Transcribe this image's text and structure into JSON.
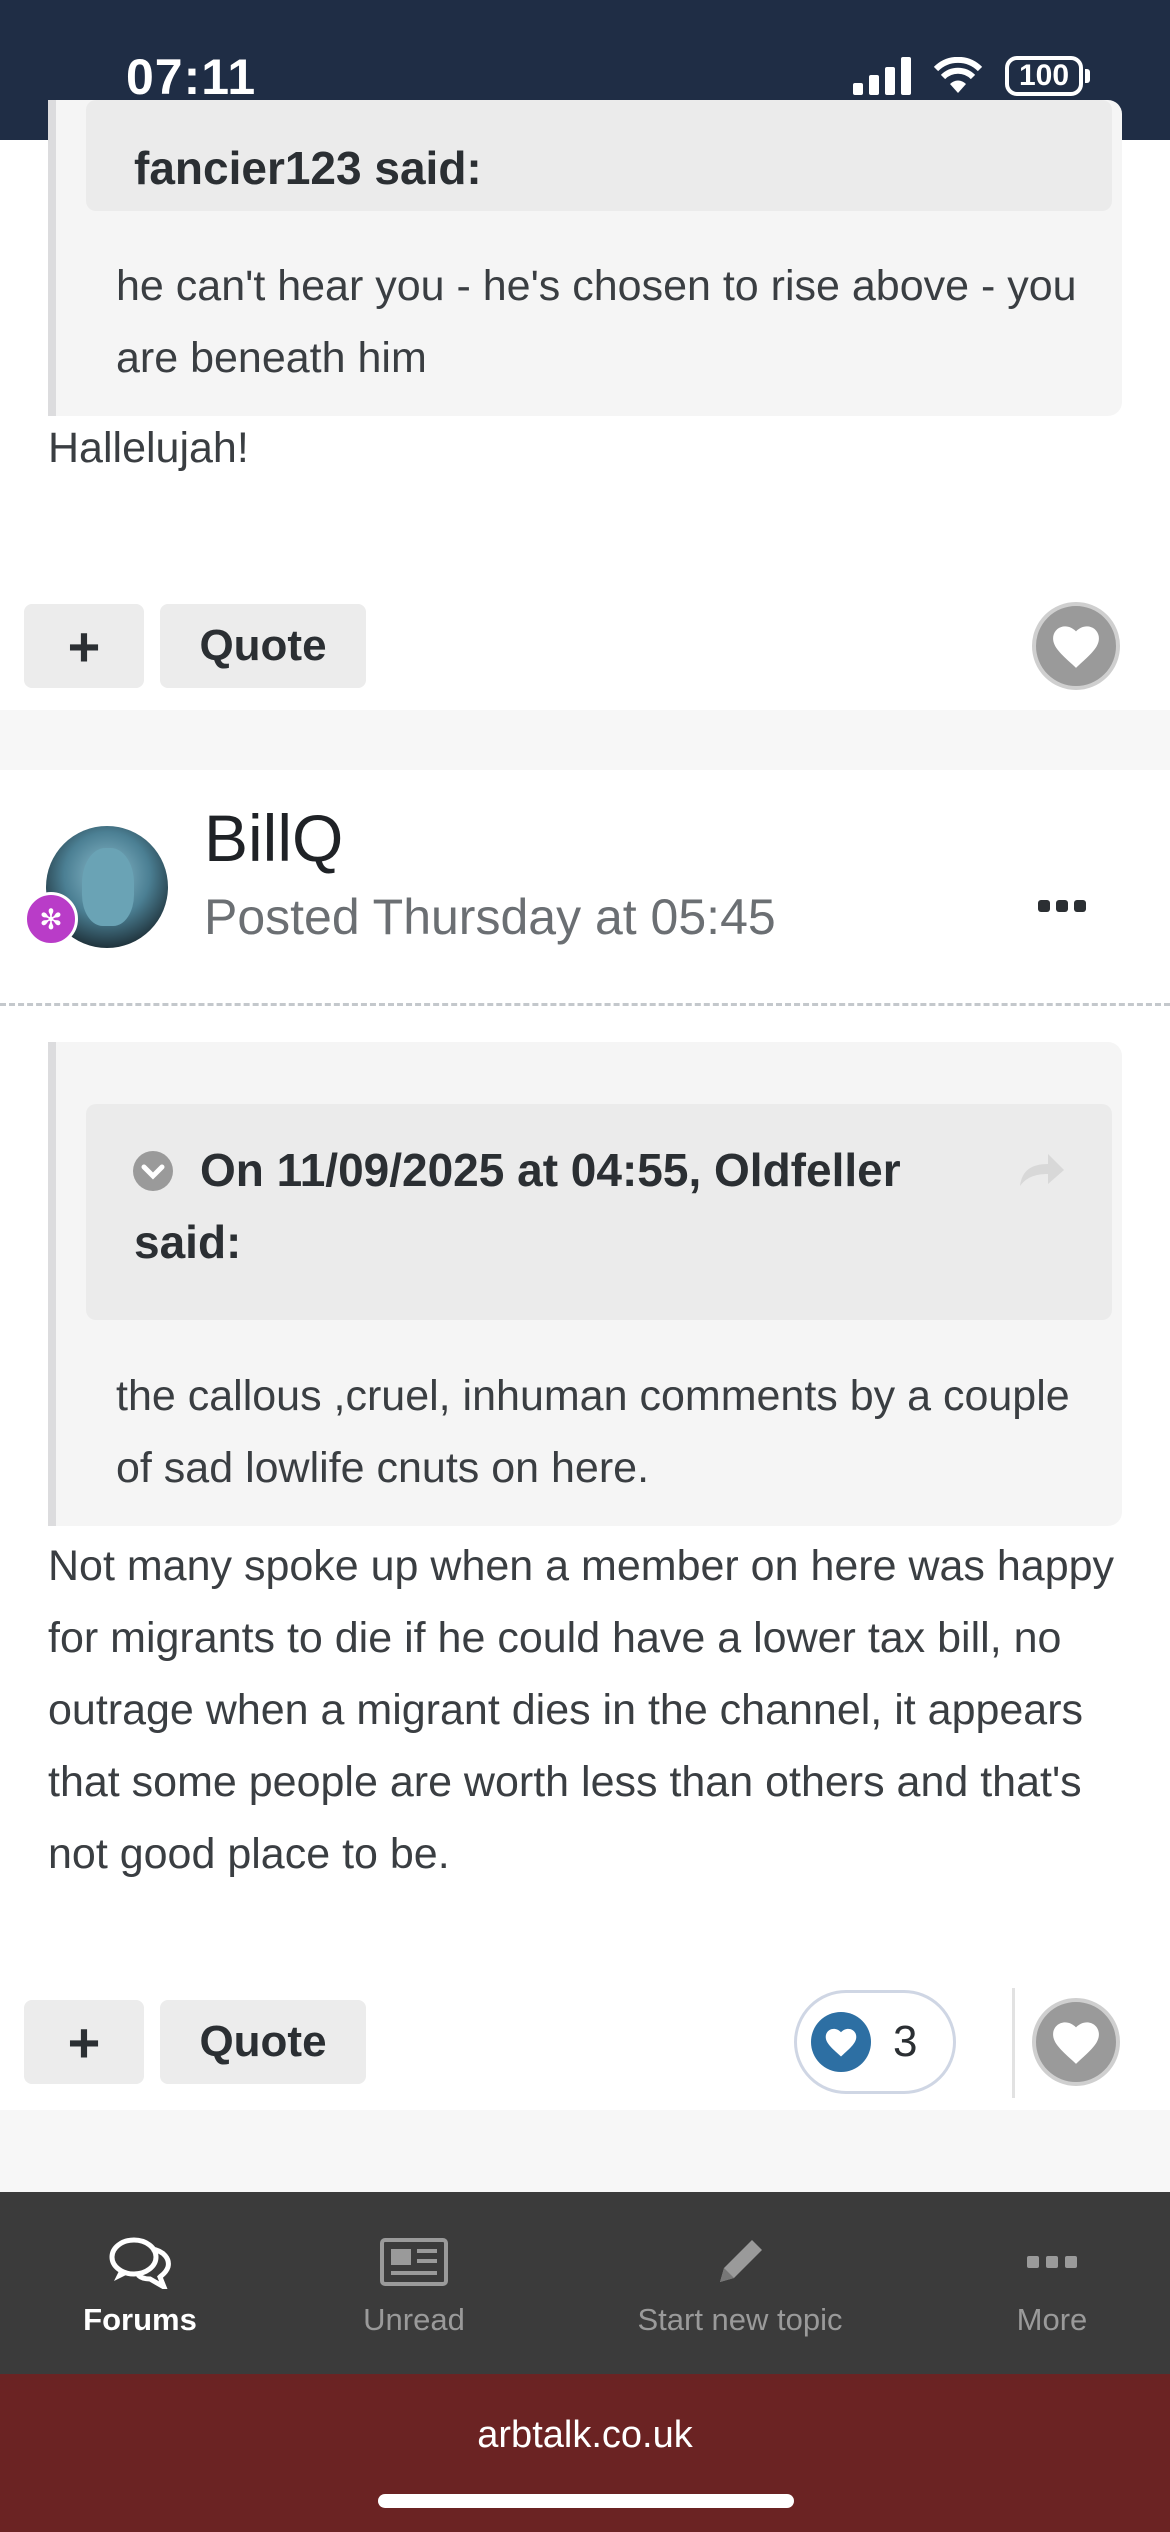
{
  "status_bar": {
    "time": "07:11",
    "battery": "100"
  },
  "post1": {
    "quote_author": "fancier123 said:",
    "quote_text": "he can't hear you - he's chosen to rise above - you are beneath him",
    "text": "Hallelujah!",
    "plus_label": "+",
    "quote_label": "Quote"
  },
  "post2": {
    "author": "BillQ",
    "posted": "Posted Thursday at 05:45",
    "quote_header": "On 11/09/2025 at 04:55, Oldfeller said:",
    "quote_text": "the callous ,cruel, inhuman comments by a couple of sad lowlife cnuts on here.",
    "text": "Not many spoke up when a member on here was happy for migrants to die if he could have a lower tax bill, no outrage when a migrant dies in the channel, it appears that some people are worth less than others and that's not good place to be.",
    "plus_label": "+",
    "quote_label": "Quote",
    "reaction_count": "3"
  },
  "bottom_nav": {
    "items": [
      {
        "label": "Forums",
        "icon": "chat-bubbles-icon",
        "active": true
      },
      {
        "label": "Unread",
        "icon": "newspaper-icon",
        "active": false
      },
      {
        "label": "Start new topic",
        "icon": "pencil-icon",
        "active": false
      },
      {
        "label": "More",
        "icon": "more-dots-icon",
        "active": false
      }
    ]
  },
  "browser": {
    "url": "arbtalk.co.uk"
  },
  "colors": {
    "status_bar": "#1f2d45",
    "nav_bg": "#3b3b3b",
    "url_bar": "#6b2323",
    "reaction_blue": "#2d6fa3",
    "badge_purple": "#b93cc8"
  }
}
